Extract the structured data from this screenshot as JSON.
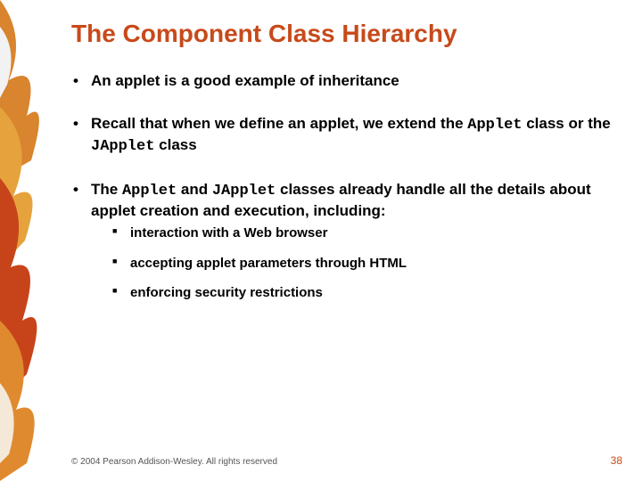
{
  "title": "The Component Class Hierarchy",
  "bullets": {
    "b1": "An applet is a good example of inheritance",
    "b2_pre": "Recall that when we define an applet, we extend the ",
    "b2_code1": "Applet",
    "b2_mid": " class or the ",
    "b2_code2": "JApplet",
    "b2_post": " class",
    "b3_pre": "The ",
    "b3_code1": "Applet",
    "b3_mid": " and ",
    "b3_code2": "JApplet",
    "b3_post": " classes already handle all the details about applet creation and execution, including:"
  },
  "sub": {
    "s1": "interaction with a Web browser",
    "s2": "accepting applet parameters through HTML",
    "s3": "enforcing security restrictions"
  },
  "footer": "© 2004 Pearson Addison-Wesley. All rights reserved",
  "page": "38"
}
